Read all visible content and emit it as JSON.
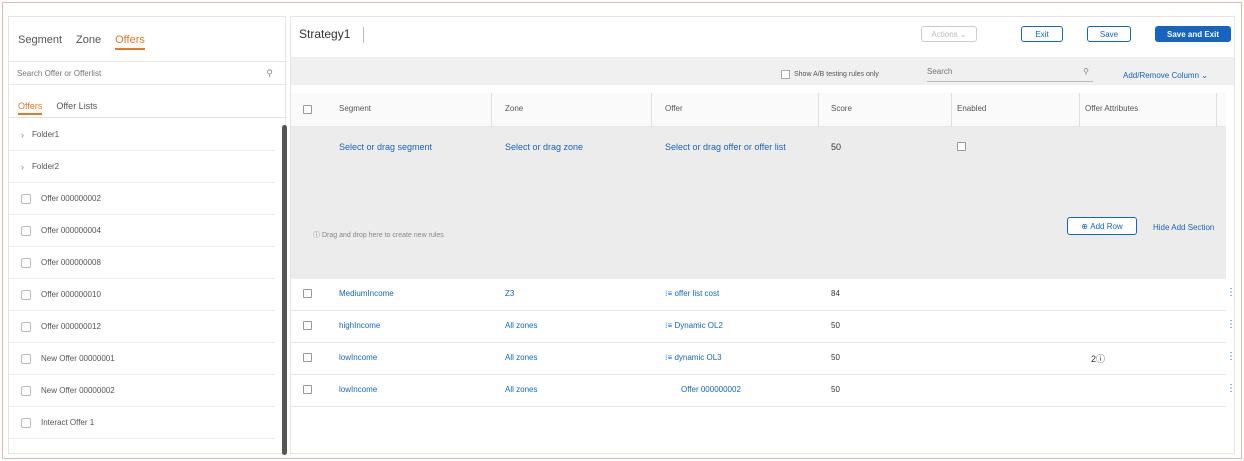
{
  "left_panel": {
    "tabs": [
      "Segment",
      "Zone",
      "Offers"
    ],
    "active_tab": "Offers",
    "search_placeholder": "Search Offer or Offerlist",
    "sub_tabs": [
      "Offers",
      "Offer Lists"
    ],
    "active_sub_tab": "Offers",
    "folders": [
      "Folder1",
      "Folder2"
    ],
    "offers": [
      "Offer 000000002",
      "Offer 000000004",
      "Offer 000000008",
      "Offer 000000010",
      "Offer 000000012",
      "New Offer 00000001",
      "New Offer 00000002",
      "Interact Offer 1"
    ]
  },
  "main": {
    "strategy_title": "Strategy1",
    "buttons": {
      "actions": "Actions",
      "exit": "Exit",
      "save": "Save",
      "save_and_exit": "Save and Exit"
    },
    "toolbar": {
      "ab_testing_label": "Show A/B testing rules only",
      "search_placeholder": "Search",
      "add_remove_columns": "Add/Remove Column"
    },
    "columns": [
      "Segment",
      "Zone",
      "Offer",
      "Score",
      "Enabled",
      "Offer Attributes"
    ],
    "add_row_section": {
      "segment_placeholder": "Select or drag segment",
      "zone_placeholder": "Select or drag zone",
      "offer_placeholder": "Select or drag offer or offer list",
      "score": "50",
      "drop_hint": "Drag and drop here to create new rules",
      "add_row_button": "Add Row",
      "hide_add_section": "Hide Add Section"
    },
    "rules": [
      {
        "segment": "MediumIncome",
        "zone": "Z3",
        "offer": "offer list cost",
        "offer_is_list": true,
        "score": "84",
        "enabled": true,
        "attributes": ""
      },
      {
        "segment": "highIncome",
        "zone": "All zones",
        "offer": "Dynamic OL2",
        "offer_is_list": true,
        "score": "50",
        "enabled": true,
        "attributes": ""
      },
      {
        "segment": "lowIncome",
        "zone": "All zones",
        "offer": "dynamic OL3",
        "offer_is_list": true,
        "score": "50",
        "enabled": true,
        "attributes": "2"
      },
      {
        "segment": "lowIncome",
        "zone": "All zones",
        "offer": "Offer 000000002",
        "offer_is_list": false,
        "score": "50",
        "enabled": true,
        "attributes": ""
      }
    ]
  },
  "colors": {
    "accent_orange": "#e8771f",
    "primary_blue": "#1565c0",
    "checkbox_blue": "#1f62c4",
    "toolbar_gray": "#f0f0f0"
  }
}
